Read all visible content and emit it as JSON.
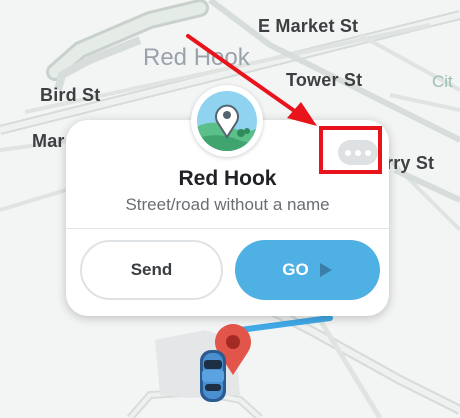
{
  "map": {
    "streets": {
      "e_market": "E Market St",
      "tower": "Tower St",
      "bird": "Bird St",
      "mar_partial": "Mar",
      "rry_partial": "rry St"
    },
    "neighborhood": "Red Hook",
    "partial_city": "Cit"
  },
  "place_card": {
    "title": "Red Hook",
    "subtitle": "Street/road without a name",
    "send_label": "Send",
    "go_label": "GO",
    "more_icon": "more-dots-icon",
    "place_icon": "map-pin-landscape-icon"
  },
  "colors": {
    "accent": "#4fb0e3",
    "annotation": "#e8131b",
    "destination_pin": "#e2554b",
    "route": "#41a9e6"
  }
}
